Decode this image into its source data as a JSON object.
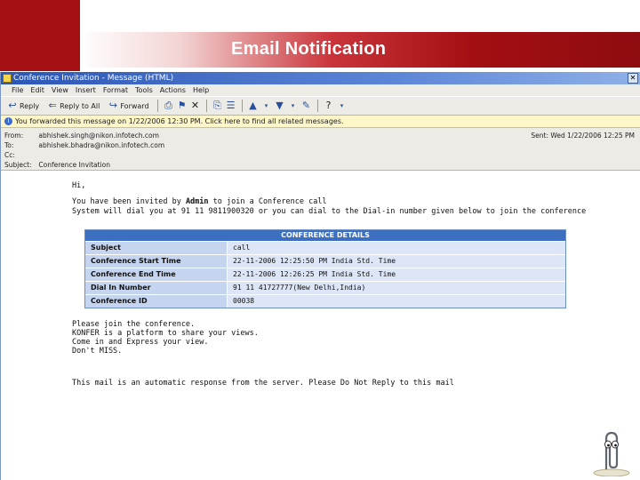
{
  "slide": {
    "title": "Email Notification"
  },
  "window": {
    "title": "Conference Invitation - Message (HTML)"
  },
  "menu": [
    "File",
    "Edit",
    "View",
    "Insert",
    "Format",
    "Tools",
    "Actions",
    "Help"
  ],
  "toolbar": {
    "reply": "Reply",
    "reply_all": "Reply to All",
    "forward": "Forward"
  },
  "infobar": {
    "text": "You forwarded this message on 1/22/2006 12:30 PM. Click here to find all related messages."
  },
  "headers": {
    "from_label": "From:",
    "from": "abhishek.singh@nikon.infotech.com",
    "to_label": "To:",
    "to": "abhishek.bhadra@nikon.infotech.com",
    "cc_label": "Cc:",
    "cc": "",
    "subject_label": "Subject:",
    "subject": "Conference Invitation",
    "sent_label": "Sent:",
    "sent": "Wed 1/22/2006 12:25 PM"
  },
  "body": {
    "greeting": "Hi,",
    "invite_pre": "You have been invited by ",
    "invite_admin": "Admin",
    "invite_post": " to join a Conference call",
    "dial_line": "System will dial you at 91 11 9811900320 or you can dial to the Dial-in number given below to join the conference",
    "closing_1": "Please join the conference.",
    "closing_2": "KONFER is a platform to share your views.",
    "closing_3": "Come in and Express your view.",
    "closing_4": "Don't MISS.",
    "auto_note": "This mail is an automatic response from the server. Please Do Not Reply to this mail"
  },
  "details": {
    "heading": "CONFERENCE DETAILS",
    "rows": [
      {
        "label": "Subject",
        "value": "call"
      },
      {
        "label": "Conference Start Time",
        "value": "22-11-2006 12:25:50 PM India Std. Time"
      },
      {
        "label": "Conference End Time",
        "value": "22-11-2006 12:26:25 PM India Std. Time"
      },
      {
        "label": "Dial In Number",
        "value": "91 11 41727777(New Delhi,India)"
      },
      {
        "label": "Conference ID",
        "value": "00038"
      }
    ]
  }
}
